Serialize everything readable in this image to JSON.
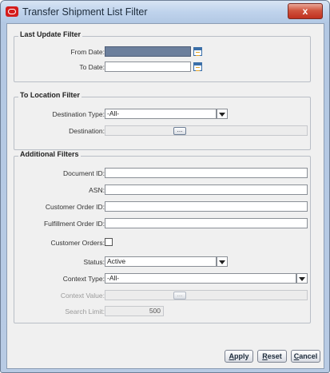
{
  "window": {
    "title": "Transfer Shipment List Filter",
    "close_label": "x"
  },
  "last_update": {
    "legend": "Last Update Filter",
    "from_label": "From Date:",
    "from_value": "",
    "to_label": "To Date:",
    "to_value": ""
  },
  "to_location": {
    "legend": "To Location Filter",
    "dest_type_label": "Destination Type:",
    "dest_type_value": "-All-",
    "dest_label": "Destination:",
    "dest_value": "",
    "ellipsis": "..."
  },
  "additional": {
    "legend": "Additional Filters",
    "doc_id_label": "Document ID:",
    "doc_id_value": "",
    "asn_label": "ASN:",
    "asn_value": "",
    "cust_order_label": "Customer Order ID:",
    "cust_order_value": "",
    "fulfill_label": "Fulfillment Order ID:",
    "fulfill_value": "",
    "cust_orders_label": "Customer Orders:",
    "status_label": "Status:",
    "status_value": "Active",
    "context_type_label": "Context Type:",
    "context_type_value": "-All-",
    "context_value_label": "Context Value:",
    "context_value_value": "",
    "ellipsis": "...",
    "search_limit_label": "Search Limit:",
    "search_limit_value": "500"
  },
  "buttons": {
    "apply_hot": "A",
    "apply_rest": "pply",
    "reset_hot": "R",
    "reset_rest": "eset",
    "cancel_hot": "C",
    "cancel_rest": "ancel"
  }
}
